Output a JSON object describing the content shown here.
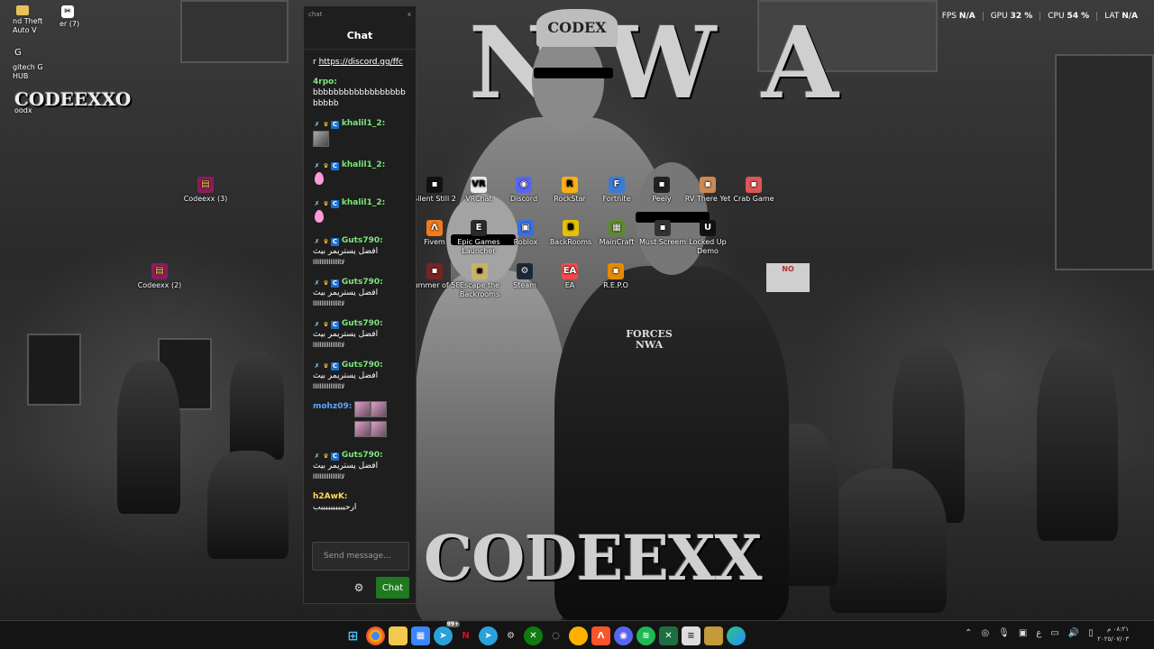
{
  "perf": {
    "fps_label": "FPS",
    "fps_value": "N/A",
    "gpu_label": "GPU",
    "gpu_value": "32 %",
    "cpu_label": "CPU",
    "cpu_value": "54 %",
    "lat_label": "LAT",
    "lat_value": "N/A"
  },
  "wallpaper": {
    "top_logo": "N W A",
    "bottom_logo": "CODEEXX",
    "cap_text": "CODEX",
    "badge_text": "FORCES NWA",
    "left_logo": "CODEEXXO",
    "sign_text": "NO"
  },
  "desktop_left": {
    "item1_line1": "nd Theft",
    "item1_line2": "Auto V",
    "item2": "er (7)",
    "item3_line1": "gitech G",
    "item3_line2": "HUB",
    "item4": "oodx"
  },
  "desktop_icons": [
    {
      "label": "Codeexx (3)",
      "icon": "winrar-icon"
    },
    {
      "label": "Codeexx (2)",
      "icon": "winrar-icon"
    },
    {
      "label": "Silent Still 2",
      "icon": "game-icon"
    },
    {
      "label": "VRChat",
      "icon": "vrchat-icon"
    },
    {
      "label": "Discord",
      "icon": "discord-icon"
    },
    {
      "label": "RockStar",
      "icon": "rockstar-icon"
    },
    {
      "label": "Fortnite",
      "icon": "fortnite-icon"
    },
    {
      "label": "Peely",
      "icon": "game-icon"
    },
    {
      "label": "RV There Yet",
      "icon": "game-icon"
    },
    {
      "label": "Crab Game",
      "icon": "game-icon"
    },
    {
      "label": "Fivem",
      "icon": "fivem-icon"
    },
    {
      "label": "Epic Games Launcher",
      "icon": "epic-icon"
    },
    {
      "label": "Roblox",
      "icon": "roblox-icon"
    },
    {
      "label": "BackRooms",
      "icon": "game-icon"
    },
    {
      "label": "MainCraft",
      "icon": "minecraft-icon"
    },
    {
      "label": "Must Screem",
      "icon": "game-icon"
    },
    {
      "label": "Locked Up Demo",
      "icon": "game-icon"
    },
    {
      "label": "Summer of 58",
      "icon": "game-icon"
    },
    {
      "label": "Escape the Backrooms",
      "icon": "game-icon"
    },
    {
      "label": "Steam",
      "icon": "steam-icon"
    },
    {
      "label": "EA",
      "icon": "ea-icon"
    },
    {
      "label": "R.E.P.O",
      "icon": "game-icon"
    }
  ],
  "chat": {
    "window_title": "chat",
    "close": "x",
    "header": "Chat",
    "messages": [
      {
        "user": "",
        "prefix": "r",
        "text": "https://discord.gg/ffc"
      },
      {
        "user": "4rpo:",
        "text": "bbbbbbbbbbbbbbbbbbbbbbb"
      },
      {
        "user": "khalil1_2:",
        "text": ""
      },
      {
        "user": "khalil1_2:",
        "text": ""
      },
      {
        "user": "khalil1_2:",
        "text": ""
      },
      {
        "user": "Guts790:",
        "text": "افضل يستريمر بيث",
        "text2": "llllllllllllllllلا"
      },
      {
        "user": "Guts790:",
        "text": "افضل يستريمر بيث",
        "text2": "llllllllllllllllلا"
      },
      {
        "user": "Guts790:",
        "text": "افضل يستريمر بيث",
        "text2": "llllllllllllllllلا"
      },
      {
        "user": "Guts790:",
        "text": "افضل يستريمر بيث",
        "text2": "llllllllllllllllلا"
      },
      {
        "user": "mohz09:",
        "text": ""
      },
      {
        "user": "Guts790:",
        "text": "افضل يستريمر بيث",
        "text2": "llllllllllllllllلا"
      },
      {
        "user": "h2AwK:",
        "text": "ارحببببببببببب"
      }
    ],
    "input_placeholder": "Send message...",
    "send_label": "Chat"
  },
  "taskbar": {
    "apps": [
      "windows-start-icon",
      "chrome-icon",
      "file-explorer-icon",
      "store-icon",
      "telegram-icon",
      "netflix-icon",
      "telegram-icon",
      "settings-icon",
      "xbox-icon",
      "loader-icon",
      "app-icon",
      "brave-icon",
      "discord-icon",
      "spotify-icon",
      "excel-icon",
      "notepad-icon",
      "game-icon",
      "edge-icon"
    ],
    "app_badge": "99+",
    "netflix_letter": "N",
    "tray_lang": "ع",
    "clock_time": "٠٨:٢١ م",
    "clock_date": "٢٠٢٥/٠٧/٠٣"
  },
  "colors": {
    "chat_bg": "#1e1e1e",
    "send_btn": "#1f7a1f",
    "username_green": "#7be67b",
    "username_blue": "#5aa7ff"
  }
}
